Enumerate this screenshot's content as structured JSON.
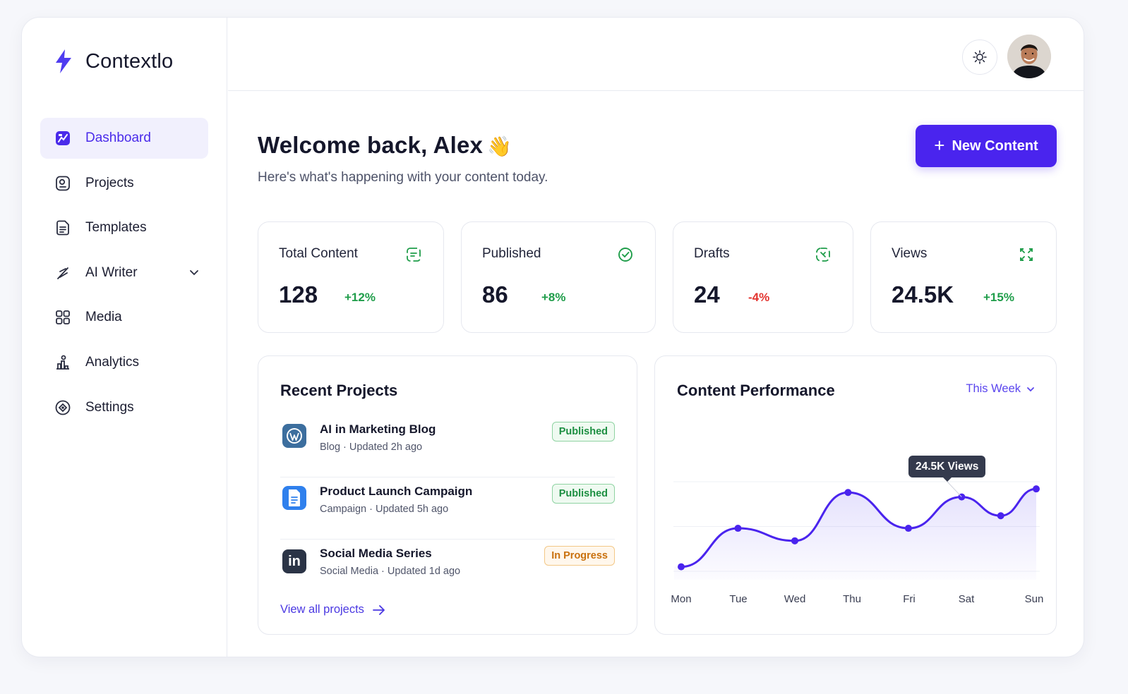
{
  "brand": {
    "name": "Contextlo"
  },
  "sidebar": {
    "items": [
      {
        "label": "Dashboard",
        "icon": "dashboard-icon",
        "active": true
      },
      {
        "label": "Projects",
        "icon": "projects-icon"
      },
      {
        "label": "Templates",
        "icon": "templates-icon"
      },
      {
        "label": "AI Writer",
        "icon": "ai-writer-icon",
        "has_submenu": true
      },
      {
        "label": "Media",
        "icon": "media-icon"
      },
      {
        "label": "Analytics",
        "icon": "analytics-icon"
      },
      {
        "label": "Settings",
        "icon": "settings-icon"
      }
    ]
  },
  "header": {
    "theme_toggle_icon": "sun-icon",
    "avatar_icon": "user-avatar"
  },
  "welcome": {
    "title": "Welcome back, Alex",
    "emoji": "👋",
    "subtitle": "Here's what's happening with your content today."
  },
  "actions": {
    "new_content": "New Content"
  },
  "stats": [
    {
      "label": "Total Content",
      "value": "128",
      "change": "+12%",
      "trend": "up",
      "icon": "content-icon"
    },
    {
      "label": "Published",
      "value": "86",
      "change": "+8%",
      "trend": "up",
      "icon": "check-circle-icon"
    },
    {
      "label": "Drafts",
      "value": "24",
      "change": "-4%",
      "trend": "down",
      "icon": "draft-icon"
    },
    {
      "label": "Views",
      "value": "24.5K",
      "change": "+15%",
      "trend": "up",
      "icon": "views-icon"
    }
  ],
  "recent_projects": {
    "title": "Recent Projects",
    "items": [
      {
        "name": "AI in Marketing Blog",
        "meta": "Blog · Updated 2h ago",
        "status": "Published",
        "logo": "wordpress-icon"
      },
      {
        "name": "Product Launch Campaign",
        "meta": "Campaign · Updated 5h ago",
        "status": "Published",
        "logo": "google-docs-icon"
      },
      {
        "name": "Social Media Series",
        "meta": "Social Media · Updated 1d ago",
        "status": "In Progress",
        "logo": "linkedin-icon"
      }
    ],
    "view_all": "View all projects"
  },
  "performance": {
    "title": "Content Performance",
    "range": "This Week",
    "tooltip": "24.5K Views"
  },
  "colors": {
    "accent": "#4a24ee",
    "positive": "#1f9d4a",
    "negative": "#e3342f",
    "line": "#4a24ee"
  },
  "chart_data": {
    "type": "line",
    "title": "Content Performance",
    "categories": [
      "Mon",
      "Tue",
      "Wed",
      "Thu",
      "Fri",
      "Sat",
      "Sun"
    ],
    "x": [
      "Mon",
      "Tue",
      "Wed",
      "Thu",
      "Fri",
      "Sat",
      "Sun"
    ],
    "values": [
      0.05,
      0.48,
      0.34,
      0.88,
      0.48,
      0.83,
      0.62,
      0.92
    ],
    "point_x": [
      0.0,
      0.16,
      0.32,
      0.47,
      0.64,
      0.79,
      0.9,
      1.0
    ],
    "series": [
      {
        "name": "Views",
        "values": [
          0.05,
          0.48,
          0.34,
          0.88,
          0.48,
          0.83,
          0.62,
          0.92
        ]
      }
    ],
    "xlabel": "",
    "ylabel": "",
    "grid": true,
    "annotation": "24.5K Views"
  }
}
